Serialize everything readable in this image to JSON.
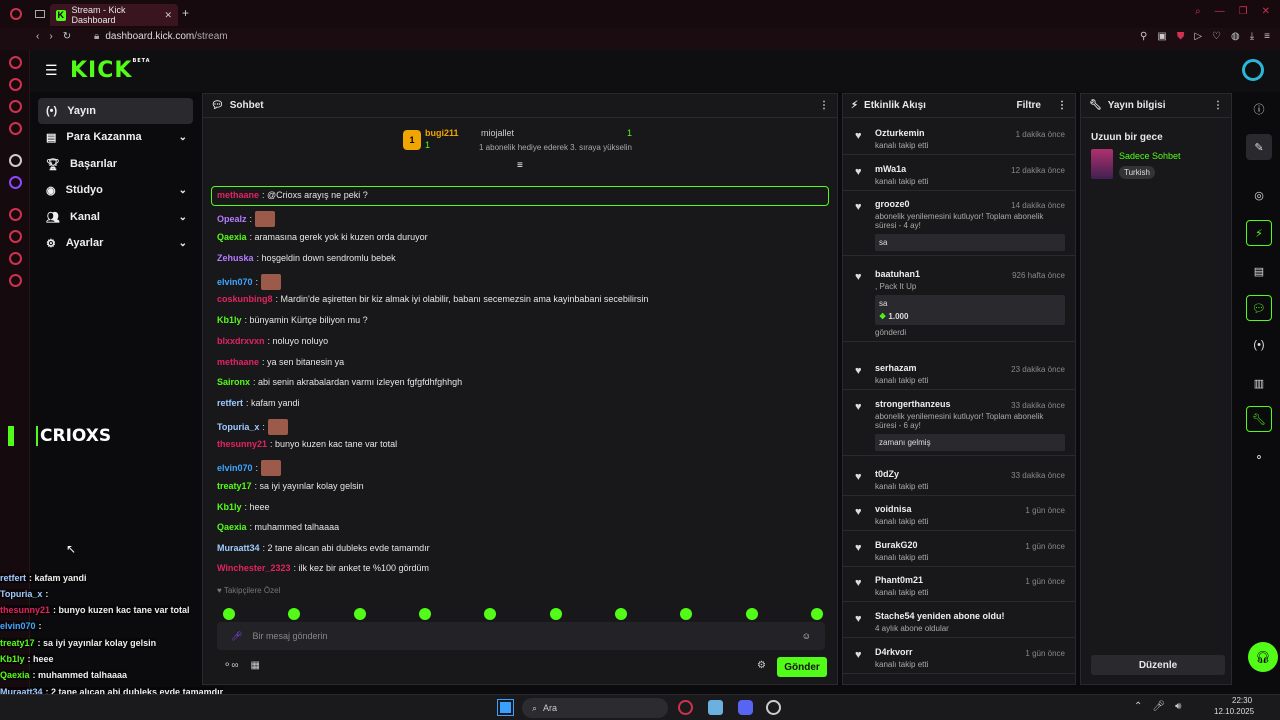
{
  "browser": {
    "tab_title": "Stream - Kick Dashboard",
    "url_host": "dashboard.kick.com",
    "url_path": "/stream"
  },
  "header": {
    "logo": "KICK",
    "beta": "BETA"
  },
  "nav": [
    {
      "label": "Yayın",
      "icon": "broadcast-icon",
      "active": true
    },
    {
      "label": "Para Kazanma",
      "icon": "dollar-icon"
    },
    {
      "label": "Başarılar",
      "icon": "trophy-icon"
    },
    {
      "label": "Stüdyo",
      "icon": "studio-icon"
    },
    {
      "label": "Kanal",
      "icon": "users-icon"
    },
    {
      "label": "Ayarlar",
      "icon": "gear-icon"
    }
  ],
  "stream_overlay_name": "CRIOXS",
  "chat": {
    "title": "Sohbet",
    "pinned": {
      "user1": "bugi211",
      "user1_count": "1",
      "user2": "miojallet",
      "user2_count": "1",
      "note": "1 abonelik hediye ederek 3. sıraya yükselin"
    },
    "messages": [
      {
        "user": "methaane",
        "text": ": @Crioxs arayış ne peki ?",
        "color": "#e0245e",
        "highlight": true
      },
      {
        "user": "Opealz",
        "text": ":",
        "color": "#b57bff",
        "emote": true
      },
      {
        "user": "Qaexia",
        "text": ": aramasına gerek yok ki kuzen orda duruyor",
        "color": "#53fc18"
      },
      {
        "user": "Zehuska",
        "text": ": hoşgeldin down sendromlu bebek",
        "color": "#b57bff"
      },
      {
        "user": "elvin070",
        "text": ":",
        "color": "#3ea6ff",
        "emote": true
      },
      {
        "user": "coskunbing8",
        "text": ": Mardin'de aşiretten bir kiz almak iyi olabilir, babanı secemezsin ama kayinbabani secebilirsin",
        "color": "#e0245e"
      },
      {
        "user": "Kb1ly",
        "text": ": bünyamin Kürtçe biliyon mu ?",
        "color": "#53fc18"
      },
      {
        "user": "blxxdrxvxn",
        "text": ": noluyo noluyo",
        "color": "#e0245e"
      },
      {
        "user": "methaane",
        "text": ": ya sen bitanesin ya",
        "color": "#e0245e"
      },
      {
        "user": "Saironx",
        "text": ": abi senin akrabalardan varmı izleyen fgfgfdhfghhgh",
        "color": "#53fc18"
      },
      {
        "user": "retfert",
        "text": ": kafam yandi",
        "color": "#9ecbff"
      },
      {
        "user": "Topuria_x",
        "text": ":",
        "color": "#9ecbff",
        "emote": true
      },
      {
        "user": "thesunny21",
        "text": ": bunyo kuzen kac tane var total",
        "color": "#e0245e"
      },
      {
        "user": "elvin070",
        "text": ":",
        "color": "#3ea6ff",
        "emote": true
      },
      {
        "user": "treaty17",
        "text": ": sa iyi yayınlar kolay gelsin",
        "color": "#53fc18"
      },
      {
        "user": "Kb1ly",
        "text": ": heee",
        "color": "#53fc18"
      },
      {
        "user": "Qaexia",
        "text": ": muhammed talhaaaa",
        "color": "#53fc18"
      },
      {
        "user": "Muraatt34",
        "text": ": 2 tane alıcan abi dubleks evde tamamdır",
        "color": "#9ecbff"
      },
      {
        "user": "Winchester_2323",
        "text": ": ilk kez bir anket te %100 gördüm",
        "color": "#e0245e"
      }
    ],
    "mode": "Takipçilere Özel",
    "input_placeholder": "Bir mesaj gönderin",
    "send": "Gönder"
  },
  "activity": {
    "title": "Etkinlik Akışı",
    "filter": "Filtre",
    "items": [
      {
        "name": "Ozturkemin",
        "sub": "kanalı takip etti",
        "time": "1 dakika önce"
      },
      {
        "name": "mWa1a",
        "sub": "kanalı takip etti",
        "time": "12 dakika önce"
      },
      {
        "name": "grooze0",
        "sub": "abonelik yenilemesini kutluyor! Toplam abonelik süresi - 4 ay!",
        "time": "14 dakika önce",
        "box": "sa"
      },
      {
        "name": "baatuhan1",
        "sub": ", Pack It Up",
        "time": "926 hafta önce",
        "box": "sa",
        "amount": "1.000",
        "extra": "gönderdi"
      },
      {
        "name": "serhazam",
        "sub": "kanalı takip etti",
        "time": "23 dakika önce"
      },
      {
        "name": "strongerthanzeus",
        "sub": "abonelik yenilemesini kutluyor! Toplam abonelik süresi - 6 ay!",
        "time": "33 dakika önce",
        "box": "zamanı gelmiş"
      },
      {
        "name": "t0dZy",
        "sub": "kanalı takip etti",
        "time": "33 dakika önce"
      },
      {
        "name": "voidnisa",
        "sub": "kanalı takip etti",
        "time": "1 gün önce"
      },
      {
        "name": "BurakG20",
        "sub": "kanalı takip etti",
        "time": "1 gün önce"
      },
      {
        "name": "Phant0m21",
        "sub": "kanalı takip etti",
        "time": "1 gün önce"
      },
      {
        "name": "Stache54 yeniden abone oldu!",
        "sub": "4 aylık abone oldular",
        "time": ""
      },
      {
        "name": "D4rkvorr",
        "sub": "kanalı takip etti",
        "time": "1 gün önce"
      }
    ]
  },
  "info": {
    "title": "Yayın bilgisi",
    "stream_title": "Uzuun bir gece",
    "category": "Sadece Sohbet",
    "tag": "Turkish",
    "edit": "Düzenle"
  },
  "overlay": [
    {
      "user": "retfert",
      "text": ": kafam yandi",
      "color": "#9ecbff"
    },
    {
      "user": "Topuria_x",
      "text": ":",
      "color": "#9ecbff"
    },
    {
      "user": "thesunny21",
      "text": ": bunyo kuzen kac tane var total",
      "color": "#e0245e"
    },
    {
      "user": "elvin070",
      "text": ":",
      "color": "#3ea6ff"
    },
    {
      "user": "treaty17",
      "text": ": sa iyi yayınlar kolay gelsin",
      "color": "#53fc18"
    },
    {
      "user": "Kb1ly",
      "text": ": heee",
      "color": "#53fc18"
    },
    {
      "user": "Qaexia",
      "text": ": muhammed talhaaaa",
      "color": "#53fc18"
    },
    {
      "user": "Muraatt34",
      "text": ": 2 tane alıcan abi dubleks evde tamamdır",
      "color": "#9ecbff"
    },
    {
      "user": "Winchester_2323",
      "text": ": ilk kez bir anket te %100 gördüm",
      "color": "#e0245e"
    }
  ],
  "taskbar": {
    "search": "Ara",
    "time": "22:30",
    "date": "12.10.2025"
  },
  "accent": "#53fc18"
}
